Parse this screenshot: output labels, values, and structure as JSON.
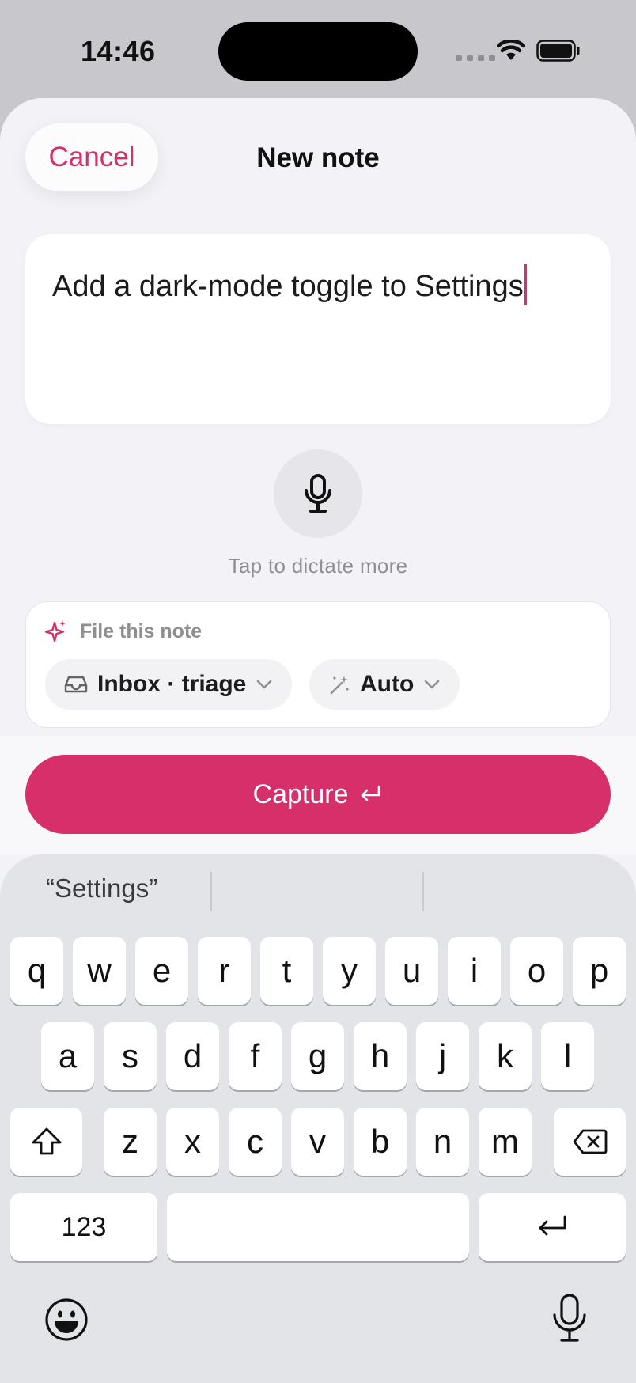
{
  "status_bar": {
    "time": "14:46"
  },
  "header": {
    "cancel_label": "Cancel",
    "title": "New note"
  },
  "note": {
    "text": "Add a dark-mode toggle to Settings"
  },
  "dictation": {
    "hint": "Tap to dictate more"
  },
  "file_card": {
    "label": "File this note",
    "destination_chip": "Inbox · triage",
    "mode_chip": "Auto"
  },
  "capture": {
    "label": "Capture",
    "icon": "return-icon"
  },
  "keyboard": {
    "suggestions": [
      "“Settings”",
      "",
      ""
    ],
    "row1": [
      "q",
      "w",
      "e",
      "r",
      "t",
      "y",
      "u",
      "i",
      "o",
      "p"
    ],
    "row2": [
      "a",
      "s",
      "d",
      "f",
      "g",
      "h",
      "j",
      "k",
      "l"
    ],
    "row3": [
      "z",
      "x",
      "c",
      "v",
      "b",
      "n",
      "m"
    ],
    "numbers_key": "123",
    "icons": [
      "shift-icon",
      "backspace-icon",
      "return-icon",
      "emoji-icon",
      "dictation-mic-icon"
    ]
  },
  "colors": {
    "accent": "#d72f6a",
    "sheet_bg": "#f2f2f7",
    "keyboard_bg": "#e3e4e8"
  }
}
